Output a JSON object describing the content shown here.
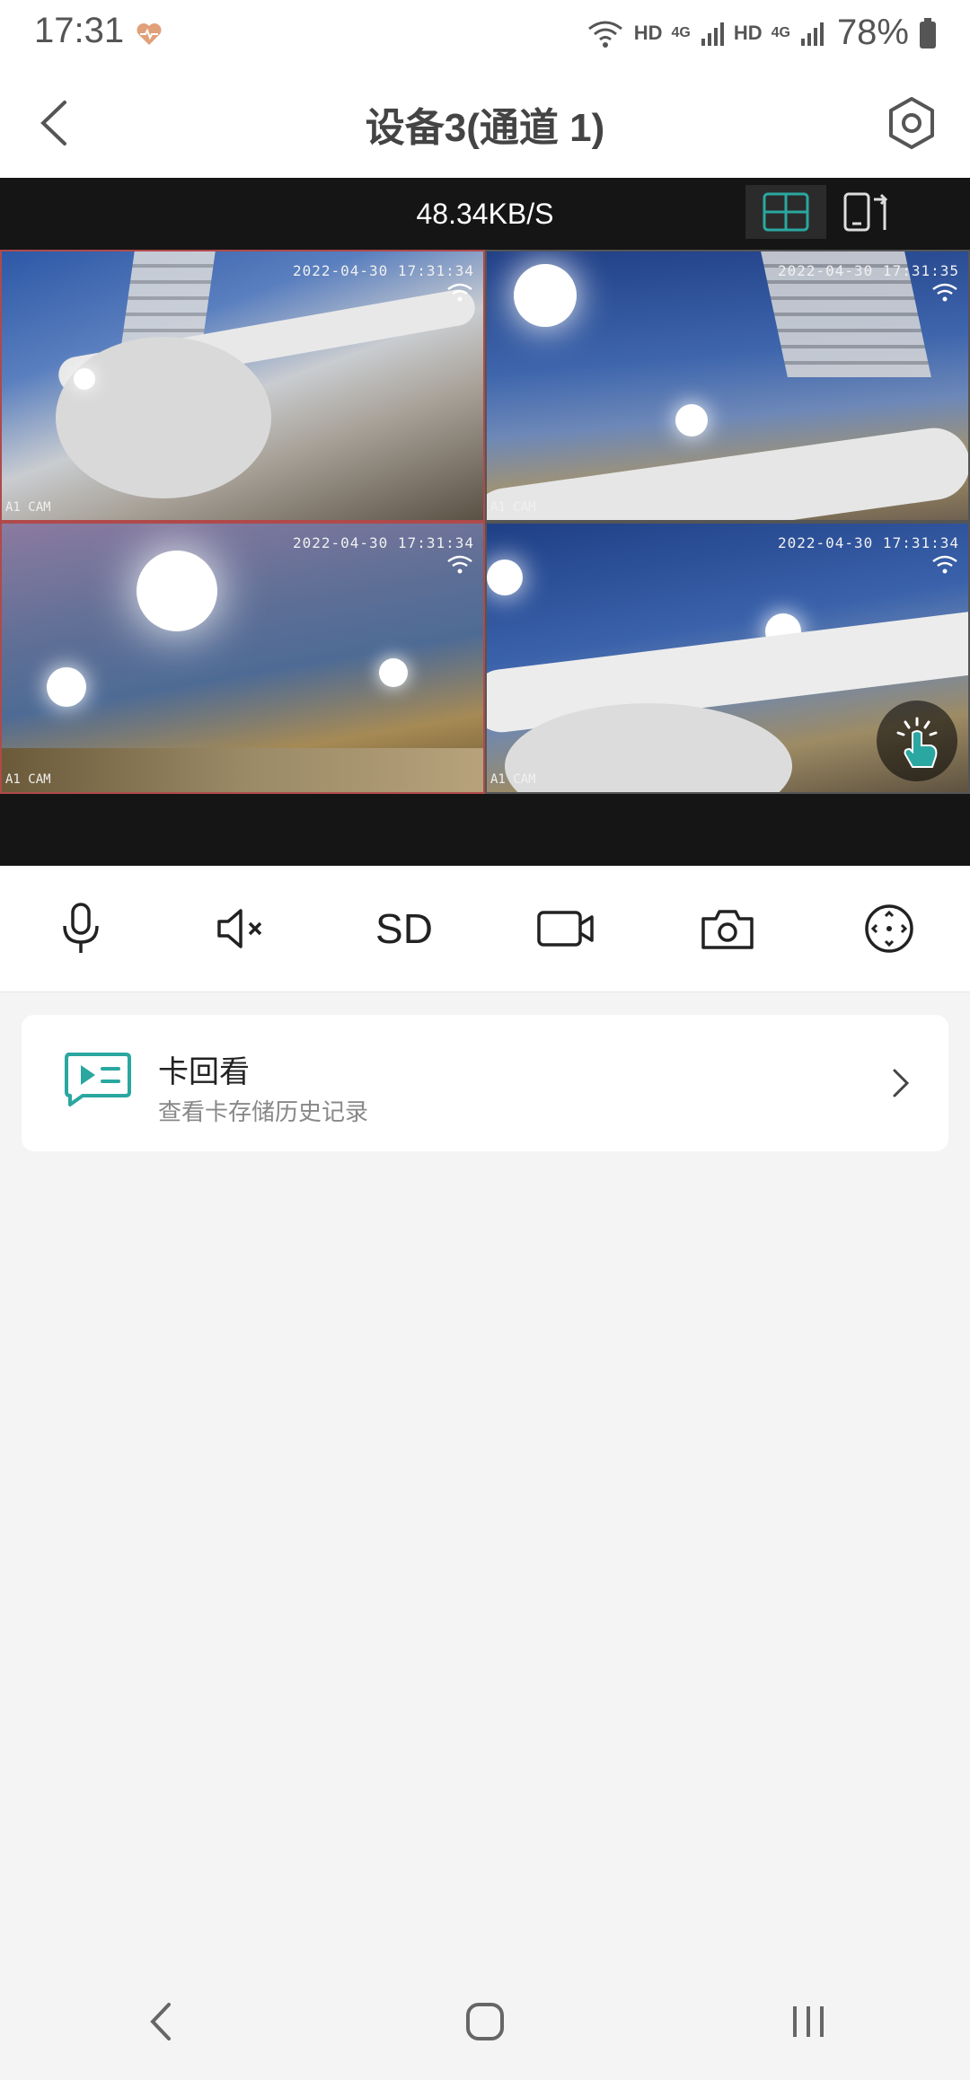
{
  "status_bar": {
    "time": "17:31",
    "hd1": "HD",
    "net1": "4G",
    "hd2": "HD",
    "net2": "4G",
    "battery": "78%",
    "icons": [
      "heart-pulse-icon",
      "wifi-icon",
      "signal-icon",
      "battery-icon"
    ]
  },
  "header": {
    "title": "设备3(通道 1)"
  },
  "video": {
    "speed": "48.34KB/S",
    "tiles": [
      {
        "timestamp": "2022-04-30 17:31:34",
        "camera": "A1 CAM"
      },
      {
        "timestamp": "2022-04-30 17:31:35",
        "camera": "A1 CAM"
      },
      {
        "timestamp": "2022-04-30 17:31:34",
        "camera": "A1 CAM"
      },
      {
        "timestamp": "2022-04-30 17:31:34",
        "camera": "A1 CAM"
      }
    ]
  },
  "controls": {
    "sd_label": "SD",
    "icons": [
      "microphone-icon",
      "mute-icon",
      "quality-sd",
      "record-icon",
      "camera-icon",
      "ptz-icon"
    ]
  },
  "playback_card": {
    "title": "卡回看",
    "subtitle": "查看卡存储历史记录"
  },
  "colors": {
    "accent": "#2aa7a0",
    "video_bg": "#151515"
  }
}
